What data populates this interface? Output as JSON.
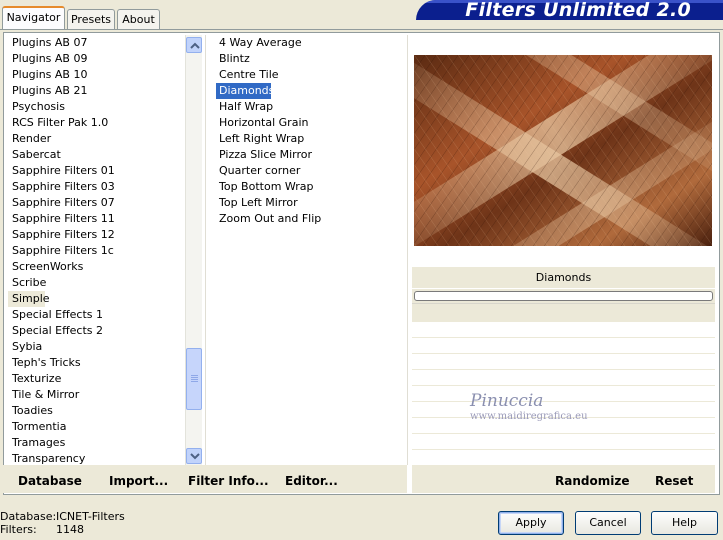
{
  "tabs": [
    {
      "label": "Navigator",
      "active": true
    },
    {
      "label": "Presets",
      "active": false
    },
    {
      "label": "About",
      "active": false
    }
  ],
  "banner": {
    "title": "Filters Unlimited 2.0"
  },
  "categories": {
    "items": [
      "Plugins AB 07",
      "Plugins AB 09",
      "Plugins AB 10",
      "Plugins AB 21",
      "Psychosis",
      "RCS Filter Pak 1.0",
      "Render",
      "Sabercat",
      "Sapphire Filters 01",
      "Sapphire Filters 03",
      "Sapphire Filters 07",
      "Sapphire Filters 11",
      "Sapphire Filters 12",
      "Sapphire Filters 1c",
      "ScreenWorks",
      "Scribe",
      "Simple",
      "Special Effects 1",
      "Special Effects 2",
      "Sybia",
      "Teph's Tricks",
      "Texturize",
      "Tile & Mirror",
      "Toadies",
      "Tormentia",
      "Tramages",
      "Transparency"
    ],
    "selected": "Simple"
  },
  "filters": {
    "items": [
      "4 Way Average",
      "Blintz",
      "Centre Tile",
      "Diamonds",
      "Half Wrap",
      "Horizontal Grain",
      "Left Right Wrap",
      "Pizza Slice Mirror",
      "Quarter corner",
      "Top Bottom Wrap",
      "Top Left Mirror",
      "Zoom Out and Flip"
    ],
    "selected": "Diamonds"
  },
  "preview": {
    "filter_name": "Diamonds",
    "progress": 0
  },
  "watermark": {
    "name": "Pinuccia",
    "url": "www.maidiregrafica.eu"
  },
  "footer_links": {
    "database": "Database",
    "import": "Import...",
    "filter_info": "Filter Info...",
    "editor": "Editor...",
    "randomize": "Randomize",
    "reset": "Reset"
  },
  "status": {
    "database_label": "Database:",
    "database_value": "ICNET-Filters",
    "filters_label": "Filters:",
    "filters_value": "1148"
  },
  "buttons": {
    "apply": "Apply",
    "cancel": "Cancel",
    "help": "Help"
  },
  "colors": {
    "selection": "#316ac5",
    "banner": "#0b1f8e",
    "tab_accent": "#e68b2c"
  }
}
